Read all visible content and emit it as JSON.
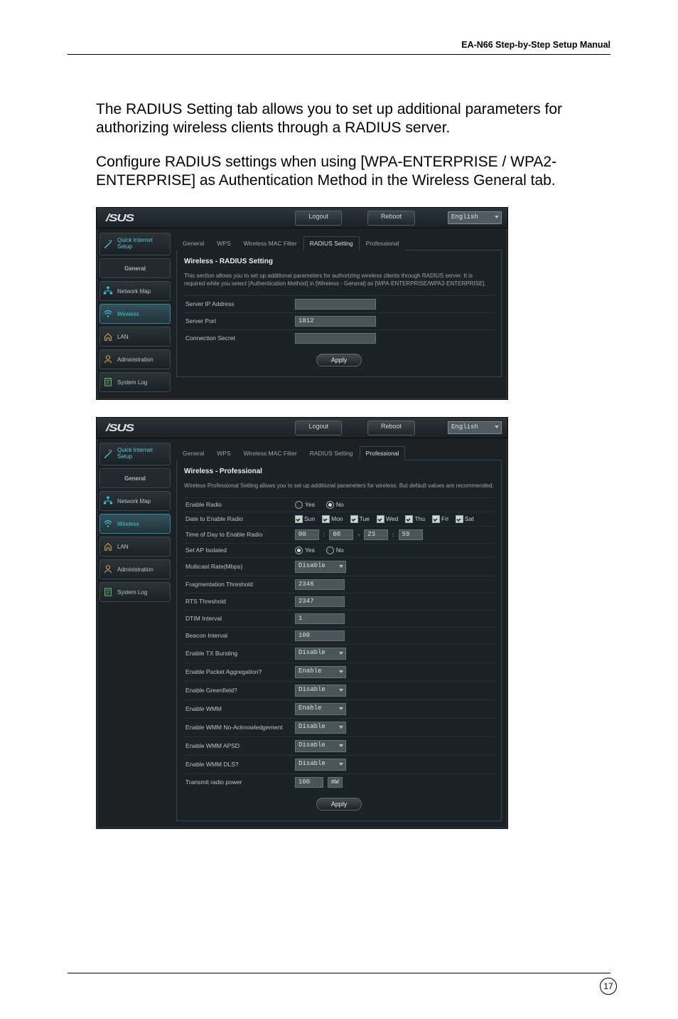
{
  "header": {
    "title": "EA-N66 Step-by-Step Setup Manual"
  },
  "paragraphs": {
    "p1": "The RADIUS Setting tab allows you to set up additional parameters for authorizing wireless clients through a RADIUS server.",
    "p2": "Configure RADIUS settings when using [WPA-ENTERPRISE / WPA2-ENTERPRISE] as Authentication Method in the Wireless General tab."
  },
  "page_number": "17",
  "brand": "/SUS",
  "topbar": {
    "logout": "Logout",
    "reboot": "Reboot",
    "language": "English"
  },
  "sidebar": {
    "qis": "Quick Internet Setup",
    "general_header": "General",
    "items": [
      {
        "label": "Network Map"
      },
      {
        "label": "Wireless"
      },
      {
        "label": "LAN"
      },
      {
        "label": "Administration"
      },
      {
        "label": "System Log"
      }
    ]
  },
  "tabs": [
    "General",
    "WPS",
    "Wireless MAC Filter",
    "RADIUS Setting",
    "Professional"
  ],
  "radius": {
    "title": "Wireless - RADIUS Setting",
    "desc": "This section allows you to set up additional parameters for authorizing wireless clients through RADIUS server. It is required while you select [Authentication Method] in [Wireless - General] as [WPA-ENTERPRISE/WPA2-ENTERPRISE].",
    "rows": {
      "server_ip_label": "Server IP Address",
      "server_ip_value": "",
      "server_port_label": "Server Port",
      "server_port_value": "1812",
      "secret_label": "Connection Secret",
      "secret_value": ""
    },
    "apply": "Apply"
  },
  "pro": {
    "title": "Wireless - Professional",
    "desc": "Wireless Professional Setting allows you to set up additional parameters for wireless. But default values are recommended.",
    "yes": "Yes",
    "no": "No",
    "rows": {
      "enable_radio": "Enable Radio",
      "date_radio": "Date to Enable Radio",
      "days": [
        "Sun",
        "Mon",
        "Tue",
        "Wed",
        "Thu",
        "Fri",
        "Sat"
      ],
      "time_radio": "Time of Day to Enable Radio",
      "time_vals": {
        "a": "00",
        "b": "00",
        "dash": "-",
        "c": "23",
        "d": "59"
      },
      "ap_isolated": "Set AP Isolated",
      "multicast": "Multicast Rate(Mbps)",
      "multicast_val": "Disable",
      "frag": "Fragmentation Threshold",
      "frag_val": "2346",
      "rts": "RTS Threshold",
      "rts_val": "2347",
      "dtim": "DTIM Interval",
      "dtim_val": "1",
      "beacon": "Beacon Interval",
      "beacon_val": "100",
      "txburst": "Enable TX Bursting",
      "txburst_val": "Disable",
      "pkt_aggr": "Enable Packet Aggregation?",
      "pkt_aggr_val": "Enable",
      "greenfield": "Enable Greenfield?",
      "greenfield_val": "Disable",
      "wmm": "Enable WMM",
      "wmm_val": "Enable",
      "wmm_noack": "Enable WMM No-Acknowledgement",
      "wmm_noack_val": "Disable",
      "wmm_apsd": "Enable WMM APSD",
      "wmm_apsd_val": "Disable",
      "wmm_dls": "Enable WMM DLS?",
      "wmm_dls_val": "Disable",
      "tx_power": "Transmit radio power",
      "tx_power_val": "100",
      "tx_power_unit": "mW"
    },
    "apply": "Apply"
  }
}
